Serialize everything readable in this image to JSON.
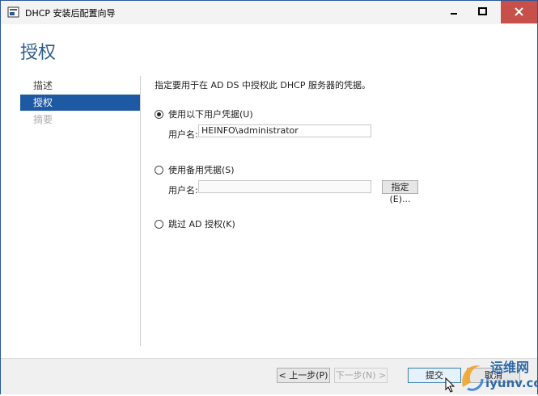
{
  "window": {
    "title": "DHCP 安装后配置向导"
  },
  "page": {
    "heading": "授权",
    "instruction": "指定要用于在 AD DS 中授权此 DHCP 服务器的凭据。"
  },
  "nav": {
    "items": [
      {
        "label": "描述",
        "state": "normal"
      },
      {
        "label": "授权",
        "state": "active"
      },
      {
        "label": "摘要",
        "state": "disabled"
      }
    ]
  },
  "options": {
    "current_user": {
      "label": "使用以下用户凭据(U)",
      "selected": true,
      "username_label": "用户名:",
      "username_value": "HEINFO\\administrator"
    },
    "alternate": {
      "label": "使用备用凭据(S)",
      "selected": false,
      "username_label": "用户名:",
      "username_value": "",
      "specify_button": "指定(E)..."
    },
    "skip": {
      "label": "跳过 AD 授权(K)",
      "selected": false
    }
  },
  "footer": {
    "prev_button": "< 上一步(P)",
    "next_button": "下一步(N) >",
    "commit_button": "提交",
    "cancel_button": "取消"
  },
  "watermark": {
    "text": "运维网",
    "url": "iyunv.com"
  },
  "colors": {
    "accent": "#1d5aa3",
    "heading": "#2e5d8a",
    "close": "#c7504a"
  }
}
